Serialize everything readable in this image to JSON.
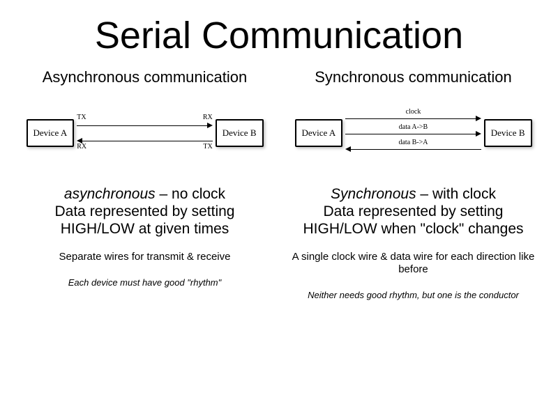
{
  "title": "Serial Communication",
  "left": {
    "heading": "Asynchronous communication",
    "diagram": {
      "deviceA": "Device A",
      "deviceB": "Device B",
      "tx1": "TX",
      "rx1": "RX",
      "rx2": "RX",
      "tx2": "TX"
    },
    "desc_em": "asynchronous",
    "desc_rest": " – no clock",
    "desc_line2": "Data represented by setting HIGH/LOW at given times",
    "note1": "Separate wires for transmit & receive",
    "note2": "Each device must have good \"rhythm\""
  },
  "right": {
    "heading": "Synchronous communication",
    "diagram": {
      "deviceA": "Device A",
      "deviceB": "Device B",
      "clock": "clock",
      "dataAB": "data A->B",
      "dataBA": "data B->A"
    },
    "desc_em": "Synchronous",
    "desc_rest": " – with clock",
    "desc_line2": "Data represented by setting HIGH/LOW when \"clock\" changes",
    "note1": "A single clock wire & data wire for each direction like before",
    "note2": "Neither needs good rhythm, but one is the conductor"
  }
}
